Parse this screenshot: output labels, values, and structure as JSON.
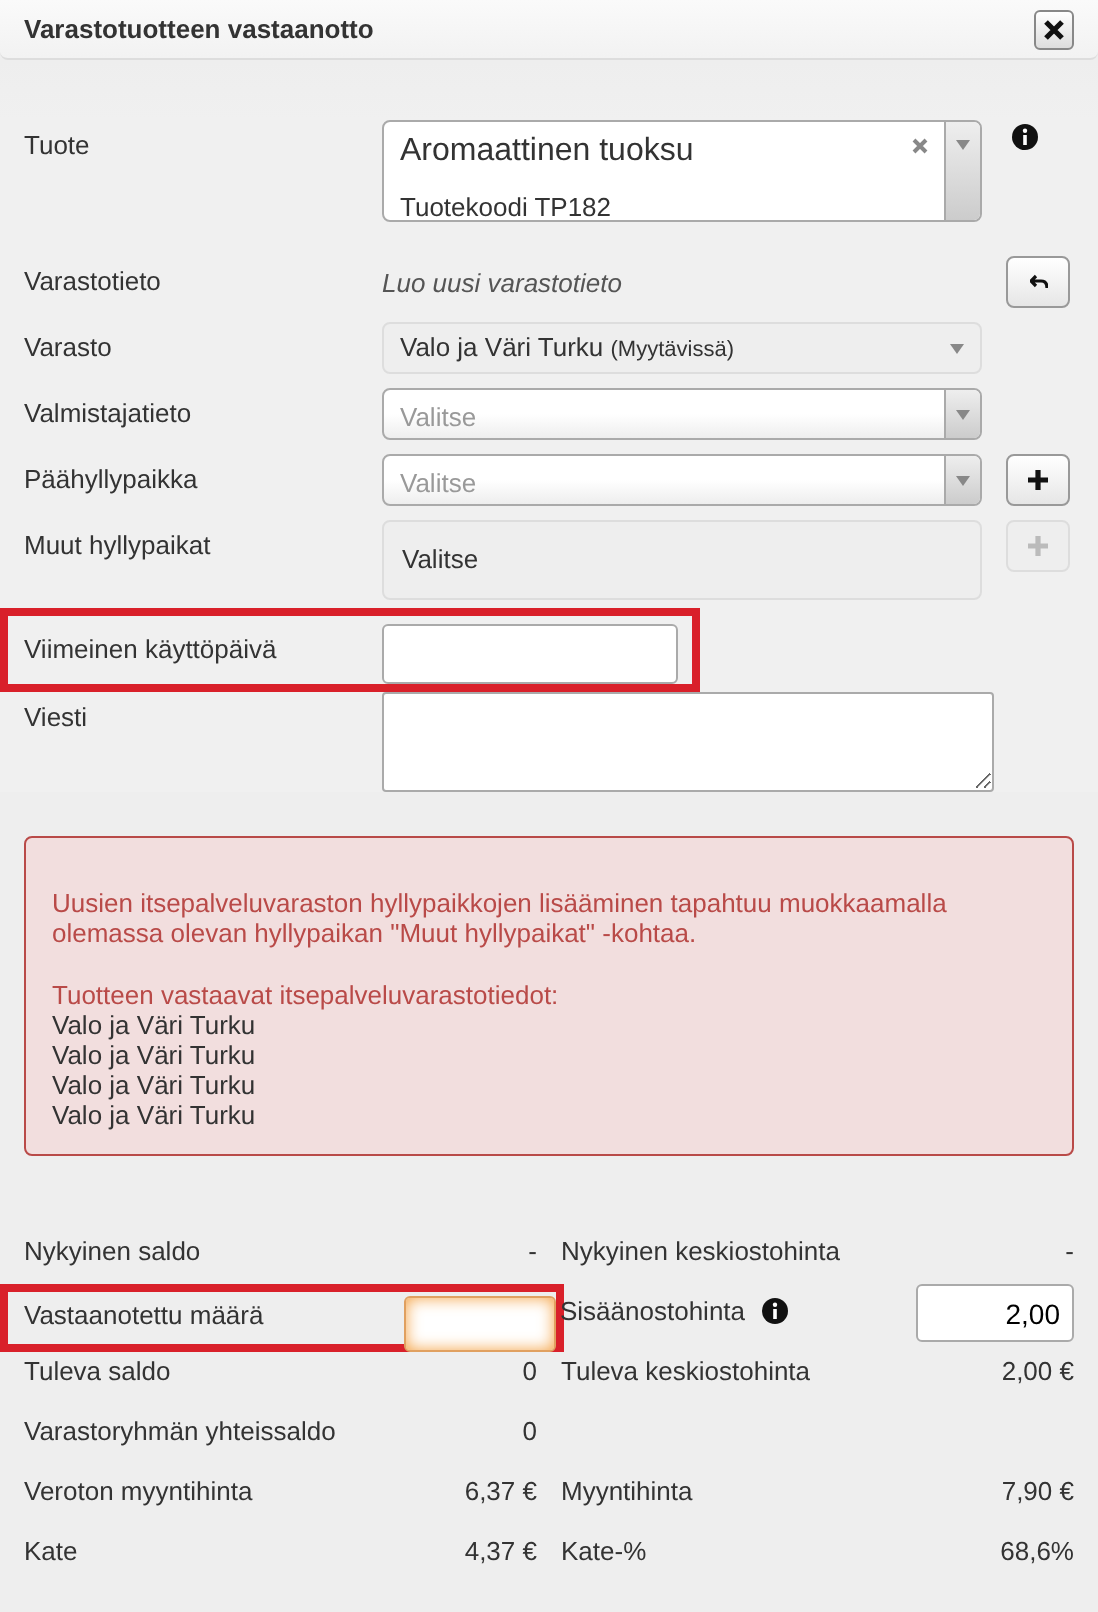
{
  "dialog": {
    "title": "Varastotuotteen vastaanotto"
  },
  "form": [
    {
      "kind": "product",
      "label": "Tuote",
      "value": "Aromaattinen tuoksu",
      "subtitle": "Tuotekoodi TP182",
      "side": {
        "kind": "info"
      }
    },
    {
      "kind": "static",
      "label": "Varastotieto",
      "value": "Luo uusi varastotieto",
      "side": {
        "kind": "undo"
      }
    },
    {
      "kind": "flat-select",
      "label": "Varasto",
      "value": "Valo ja Väri Turku",
      "note": "(Myytävissä)"
    },
    {
      "kind": "select",
      "label": "Valmistajatieto",
      "placeholder": "Valitse"
    },
    {
      "kind": "select",
      "label": "Päähyllypaikka",
      "placeholder": "Valitse",
      "side": {
        "kind": "add"
      }
    },
    {
      "kind": "multi",
      "label": "Muut hyllypaikat",
      "placeholder": "Valitse",
      "disabled": true,
      "side": {
        "kind": "add"
      }
    },
    {
      "kind": "date",
      "label": "Viimeinen käyttöpäivä",
      "highlighted": true
    },
    {
      "kind": "textarea",
      "label": "Viesti"
    }
  ],
  "alert": {
    "message": "Uusien itsepalveluvaraston hyllypaikkojen lisääminen tapahtuu muokkaamalla olemassa olevan hyllypaikan \"Muut hyllypaikat\" -kohtaa.",
    "list_title": "Tuotteen vastaavat itsepalveluvarastotiedot:",
    "items": [
      "Valo ja Väri Turku",
      "Valo ja Väri Turku",
      "Valo ja Väri Turku",
      "Valo ja Väri Turku"
    ]
  },
  "stats": [
    {
      "left": {
        "label": "Nykyinen saldo",
        "value": "-"
      },
      "right": {
        "label": "Nykyinen keskiostohinta",
        "value": "-"
      }
    },
    {
      "left": {
        "label": "Vastaanotettu määrä",
        "kind": "input",
        "focused": true,
        "highlighted": true
      },
      "right": {
        "label": "Sisäänostohinta",
        "kind": "input",
        "value": "2,00",
        "info": true
      }
    },
    {
      "left": {
        "label": "Tuleva saldo",
        "value": "0"
      },
      "right": {
        "label": "Tuleva keskiostohinta",
        "value": "2,00 €"
      }
    },
    {
      "left": {
        "label": "Varastoryhmän yhteissaldo",
        "value": "0"
      }
    },
    {
      "left": {
        "label": "Veroton myyntihinta",
        "value": "6,37 €"
      },
      "right": {
        "label": "Myyntihinta",
        "value": "7,90 €"
      }
    },
    {
      "left": {
        "label": "Kate",
        "value": "4,37 €"
      },
      "right": {
        "label": "Kate-%",
        "value": "68,6%"
      }
    }
  ]
}
